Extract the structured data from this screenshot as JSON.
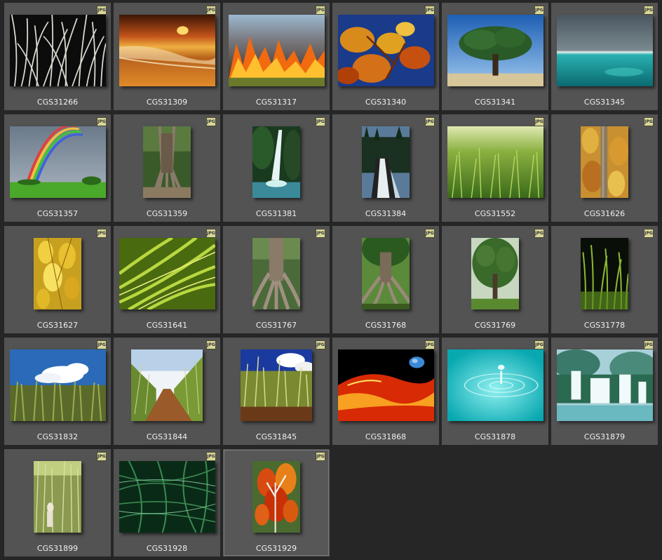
{
  "badge_text": "JPG",
  "items": [
    {
      "label": "CGS31266",
      "scene": "grass-white",
      "orient": "land",
      "name": "thumb-grass-white"
    },
    {
      "label": "CGS31309",
      "scene": "sunset-beach",
      "orient": "land",
      "name": "thumb-sunset-beach"
    },
    {
      "label": "CGS31317",
      "scene": "fire",
      "orient": "land",
      "name": "thumb-fire"
    },
    {
      "label": "CGS31340",
      "scene": "autumn-leaves",
      "orient": "land",
      "name": "thumb-autumn-leaves"
    },
    {
      "label": "CGS31341",
      "scene": "lone-tree",
      "orient": "land",
      "name": "thumb-lone-tree"
    },
    {
      "label": "CGS31345",
      "scene": "ocean",
      "orient": "land",
      "name": "thumb-ocean"
    },
    {
      "label": "CGS31357",
      "scene": "rainbow",
      "orient": "land",
      "name": "thumb-rainbow"
    },
    {
      "label": "CGS31359",
      "scene": "banyan",
      "orient": "port",
      "name": "thumb-banyan"
    },
    {
      "label": "CGS31381",
      "scene": "waterfall",
      "orient": "port",
      "name": "thumb-waterfall"
    },
    {
      "label": "CGS31384",
      "scene": "waterfall-forest",
      "orient": "port",
      "name": "thumb-waterfall-forest"
    },
    {
      "label": "CGS31552",
      "scene": "green-grass",
      "orient": "land",
      "name": "thumb-green-grass"
    },
    {
      "label": "CGS31626",
      "scene": "yellow-forest",
      "orient": "port",
      "name": "thumb-yellow-forest"
    },
    {
      "label": "CGS31627",
      "scene": "yellow-leaves",
      "orient": "port",
      "name": "thumb-yellow-leaves"
    },
    {
      "label": "CGS31641",
      "scene": "grass-blades",
      "orient": "land",
      "name": "thumb-grass-blades"
    },
    {
      "label": "CGS31767",
      "scene": "roots",
      "orient": "port",
      "name": "thumb-roots"
    },
    {
      "label": "CGS31768",
      "scene": "roots-tree",
      "orient": "port",
      "name": "thumb-roots-tree"
    },
    {
      "label": "CGS31769",
      "scene": "green-tree",
      "orient": "port",
      "name": "thumb-green-tree"
    },
    {
      "label": "CGS31778",
      "scene": "dark-grass",
      "orient": "port",
      "name": "thumb-dark-grass"
    },
    {
      "label": "CGS31832",
      "scene": "cane-sky",
      "orient": "land",
      "name": "thumb-cane-sky"
    },
    {
      "label": "CGS31844",
      "scene": "cane-road",
      "orient": "land-small",
      "name": "thumb-cane-road"
    },
    {
      "label": "CGS31845",
      "scene": "cane-blue",
      "orient": "land-small",
      "name": "thumb-cane-blue"
    },
    {
      "label": "CGS31868",
      "scene": "lava-planet",
      "orient": "land",
      "name": "thumb-lava-planet"
    },
    {
      "label": "CGS31878",
      "scene": "water-drop",
      "orient": "land",
      "name": "thumb-water-drop"
    },
    {
      "label": "CGS31879",
      "scene": "cascade",
      "orient": "land",
      "name": "thumb-cascade"
    },
    {
      "label": "CGS31899",
      "scene": "cane-worker",
      "orient": "port",
      "name": "thumb-cane-worker"
    },
    {
      "label": "CGS31928",
      "scene": "dense-grass",
      "orient": "land",
      "name": "thumb-dense-grass"
    },
    {
      "label": "CGS31929",
      "scene": "autumn-tree",
      "orient": "port",
      "name": "thumb-autumn-tree",
      "selected": true
    }
  ]
}
